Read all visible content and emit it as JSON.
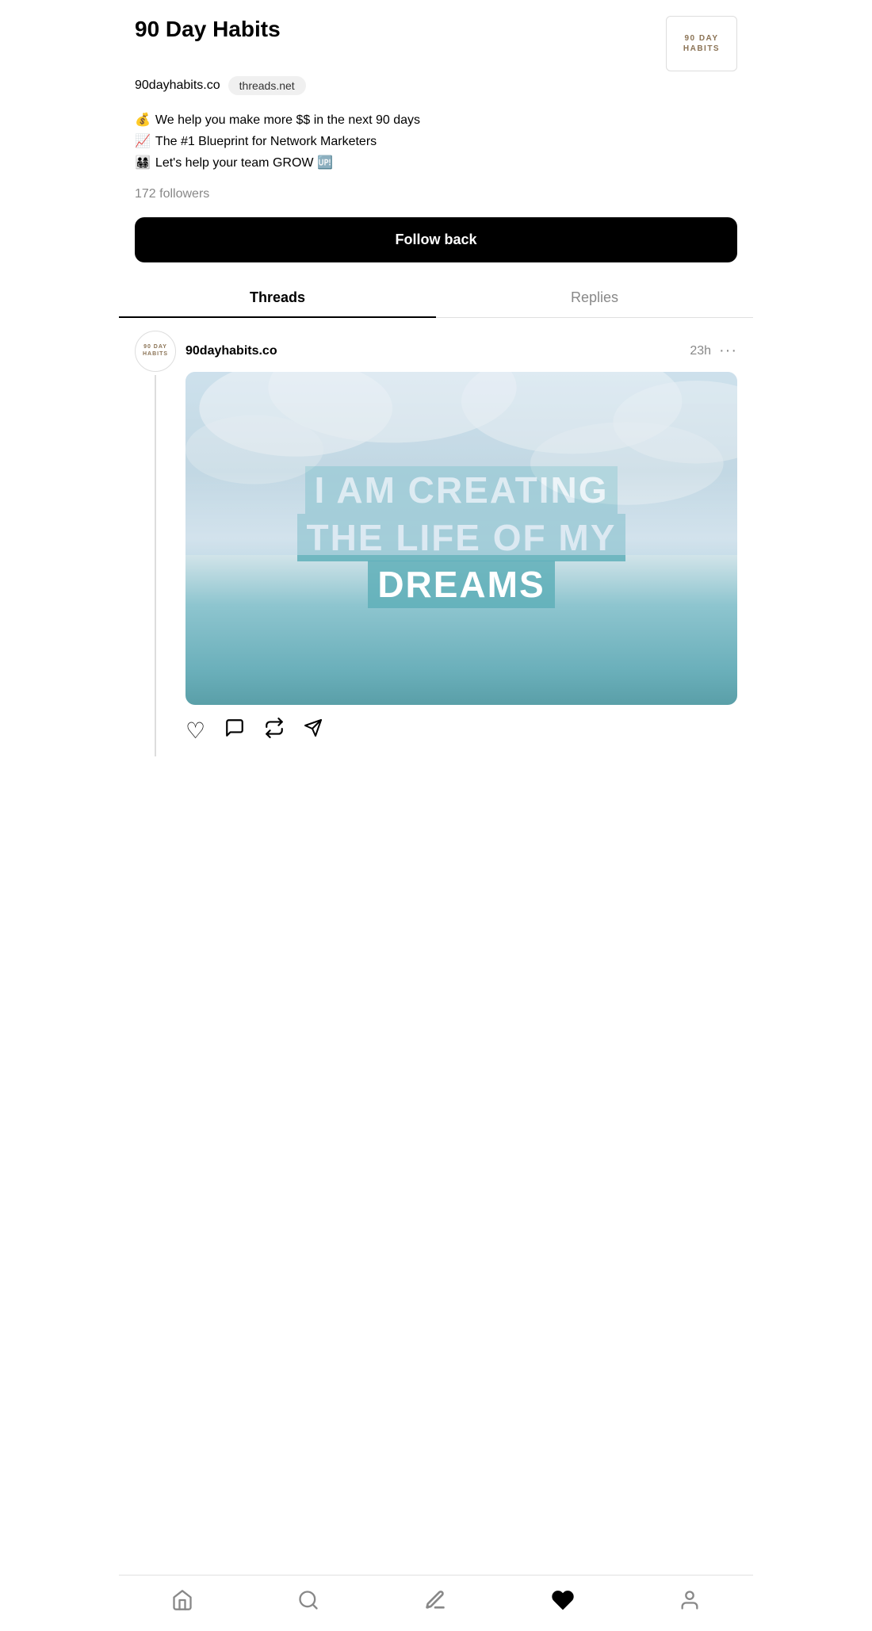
{
  "profile": {
    "name": "90 Day Habits",
    "username": "90dayhabits.co",
    "badge": "threads.net",
    "logo_line1": "90 DAY",
    "logo_line2": "HABITS",
    "bio": [
      {
        "emoji": "💰",
        "text": "We help you make more $$ in the next 90 days"
      },
      {
        "emoji": "📈",
        "text": "The #1 Blueprint for Network Marketers"
      },
      {
        "emoji": "👨‍👩‍👧‍👦",
        "text": "Let's help your team GROW 🆙"
      }
    ],
    "followers": "172 followers",
    "follow_button": "Follow back"
  },
  "tabs": {
    "active": "Threads",
    "items": [
      "Threads",
      "Replies"
    ]
  },
  "post": {
    "username": "90dayhabits.co",
    "time": "23h",
    "avatar_line1": "90 DAY",
    "avatar_line2": "HABITS",
    "image_text_line1": "I AM CREATING",
    "image_text_line2": "THE LIFE OF MY",
    "image_text_line3": "DREAMS",
    "actions": [
      "♡",
      "💬",
      "⟳",
      "▷"
    ]
  },
  "nav": {
    "items": [
      {
        "icon": "home",
        "label": "Home",
        "active": false
      },
      {
        "icon": "search",
        "label": "Search",
        "active": false
      },
      {
        "icon": "post",
        "label": "New Post",
        "active": false
      },
      {
        "icon": "heart",
        "label": "Activity",
        "active": true
      },
      {
        "icon": "profile",
        "label": "Profile",
        "active": false
      }
    ]
  }
}
